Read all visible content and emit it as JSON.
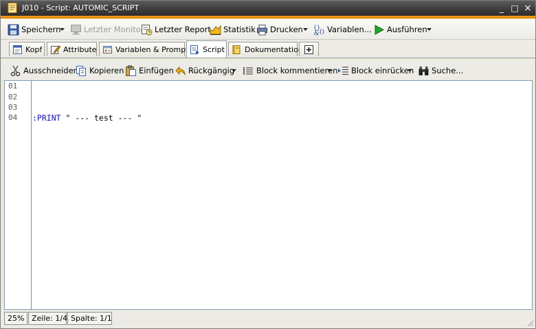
{
  "window": {
    "title": "J010 - Script: AUTOMIC_SCRIPT",
    "minimize_symbol": "_",
    "maximize_symbol": "□",
    "close_symbol": "×"
  },
  "main_toolbar": {
    "save": "Speichern",
    "last_monitor": "Letzter Monitor",
    "last_report": "Letzter Report",
    "statistics": "Statistik",
    "print": "Drucken",
    "variables": "Variablen...",
    "execute": "Ausführen"
  },
  "tabs": [
    {
      "label": "Kopf",
      "icon": "header-icon"
    },
    {
      "label": "Attribute",
      "icon": "attribute-icon"
    },
    {
      "label": "Variablen & Prompts",
      "icon": "variables-prompts-icon"
    },
    {
      "label": "Script",
      "icon": "script-icon",
      "active": true
    },
    {
      "label": "Dokumentation",
      "icon": "documentation-icon"
    },
    {
      "label": "",
      "icon": "add-tab-icon"
    }
  ],
  "edit_toolbar": {
    "cut": "Ausschneiden",
    "copy": "Kopieren",
    "paste": "Einfügen",
    "undo": "Rückgängig",
    "comment_block": "Block kommentieren",
    "indent_block": "Block einrücken",
    "search": "Suche..."
  },
  "editor": {
    "line_numbers": [
      "01",
      "02",
      "03",
      "04"
    ],
    "lines": [
      "",
      "",
      "",
      ":PRINT \" --- test --- \""
    ],
    "keyword": ":PRINT",
    "line4_rest": " \" --- test --- \""
  },
  "status": {
    "zoom": "25%",
    "line": "Zeile: 1/4",
    "column": "Spalte: 1/1"
  },
  "colors": {
    "accent_bar": "#f08a00",
    "title_bar": "#3b3b3b",
    "keyword": "#1414a8"
  }
}
